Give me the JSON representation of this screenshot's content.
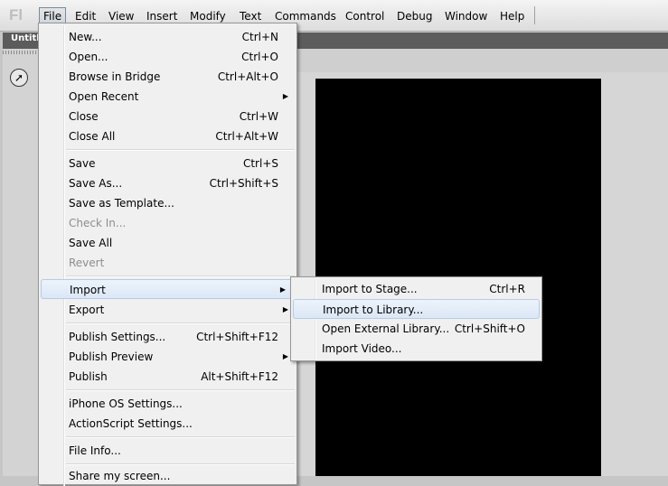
{
  "app": {
    "logo": "Fl"
  },
  "menubar": {
    "items": [
      "File",
      "Edit",
      "View",
      "Insert",
      "Modify",
      "Text",
      "Commands",
      "Control",
      "Debug",
      "Window",
      "Help"
    ]
  },
  "document": {
    "tab_title": "Untitl"
  },
  "file_menu": {
    "items": [
      {
        "label": "New...",
        "shortcut": "Ctrl+N"
      },
      {
        "label": "Open...",
        "shortcut": "Ctrl+O"
      },
      {
        "label": "Browse in Bridge",
        "shortcut": "Ctrl+Alt+O"
      },
      {
        "label": "Open Recent",
        "shortcut": "",
        "submenu": true
      },
      {
        "label": "Close",
        "shortcut": "Ctrl+W"
      },
      {
        "label": "Close All",
        "shortcut": "Ctrl+Alt+W"
      },
      {
        "label": "Save",
        "shortcut": "Ctrl+S"
      },
      {
        "label": "Save As...",
        "shortcut": "Ctrl+Shift+S"
      },
      {
        "label": "Save as Template...",
        "shortcut": ""
      },
      {
        "label": "Check In...",
        "shortcut": "",
        "disabled": true
      },
      {
        "label": "Save All",
        "shortcut": ""
      },
      {
        "label": "Revert",
        "shortcut": "",
        "disabled": true
      },
      {
        "label": "Import",
        "shortcut": "",
        "submenu": true,
        "highlighted": true
      },
      {
        "label": "Export",
        "shortcut": "",
        "submenu": true
      },
      {
        "label": "Publish Settings...",
        "shortcut": "Ctrl+Shift+F12"
      },
      {
        "label": "Publish Preview",
        "shortcut": "",
        "submenu": true
      },
      {
        "label": "Publish",
        "shortcut": "Alt+Shift+F12"
      },
      {
        "label": "iPhone OS Settings...",
        "shortcut": ""
      },
      {
        "label": "ActionScript Settings...",
        "shortcut": ""
      },
      {
        "label": "File Info...",
        "shortcut": ""
      },
      {
        "label": "Share my screen...",
        "shortcut": ""
      }
    ]
  },
  "import_menu": {
    "items": [
      {
        "label": "Import to Stage...",
        "shortcut": "Ctrl+R"
      },
      {
        "label": "Import to Library...",
        "shortcut": "",
        "highlighted": true
      },
      {
        "label": "Open External Library...",
        "shortcut": "Ctrl+Shift+O"
      },
      {
        "label": "Import Video...",
        "shortcut": ""
      }
    ]
  },
  "icons": {
    "submenu": "triangle-right-icon",
    "tool": "arrow-circle-icon"
  }
}
